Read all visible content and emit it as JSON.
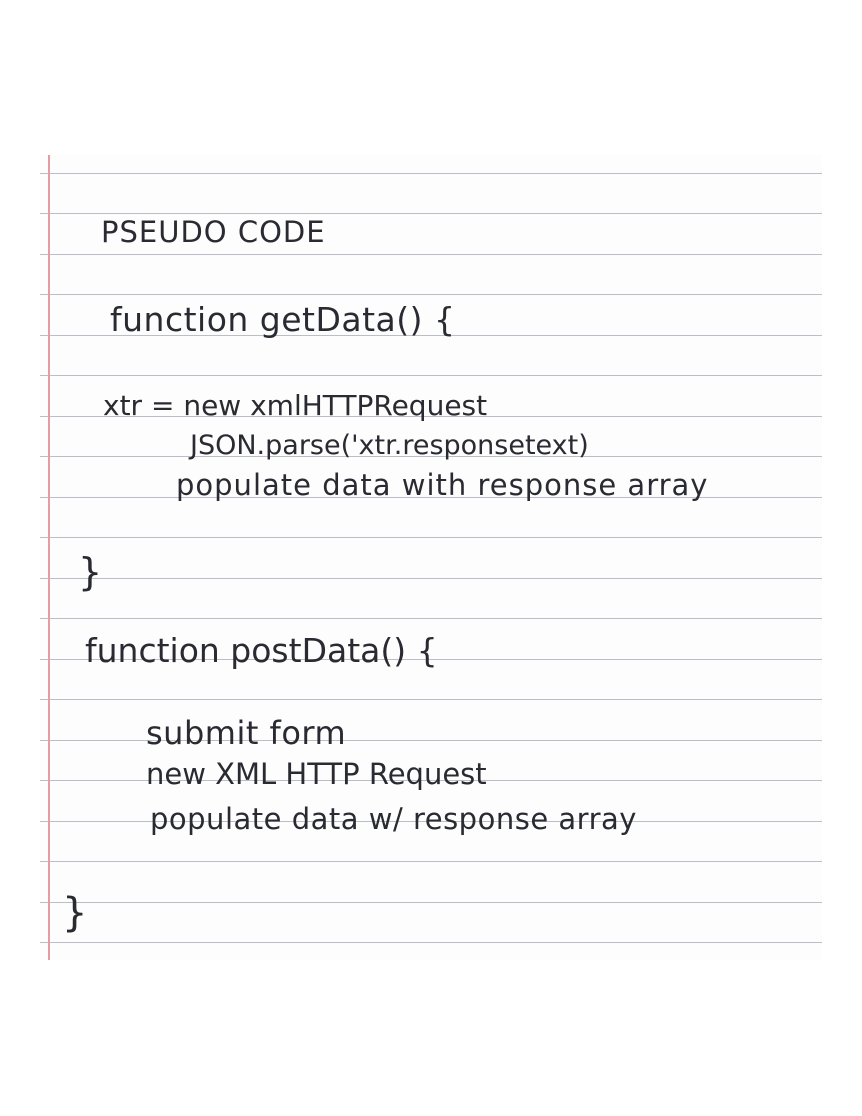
{
  "notebook": {
    "heading": "PSEUDO CODE",
    "functions": [
      {
        "signature": "function getData() {",
        "body": [
          "xtr = new xmlHTTPRequest",
          "JSON.parse('xtr.responsetext)",
          "populate data with response array"
        ],
        "closing": "}"
      },
      {
        "signature": "function postData() {",
        "body": [
          "submit form",
          "new XML HTTP Request",
          "populate data w/ response array"
        ],
        "closing": "}"
      }
    ]
  },
  "colors": {
    "ink": "#2a2a32",
    "ruled_line": "#b9bec7",
    "margin_line": "#e59aa4",
    "paper": "#fdfdfd"
  }
}
